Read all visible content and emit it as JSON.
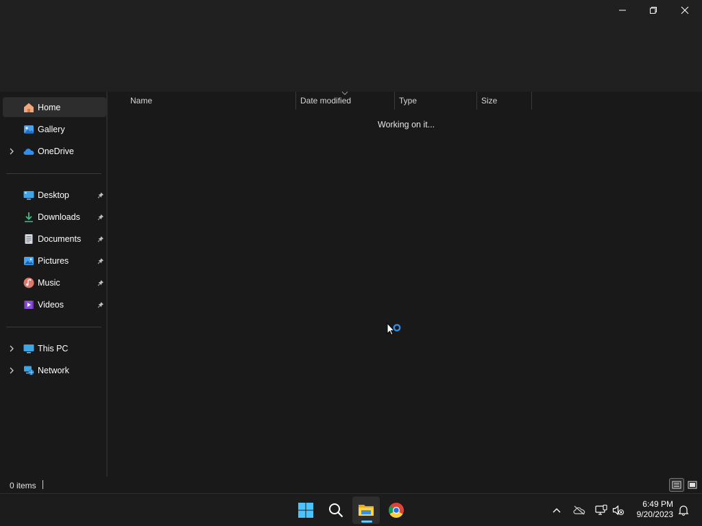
{
  "window": {
    "minimize_icon": "minimize-icon",
    "maximize_icon": "restore-icon",
    "close_icon": "close-icon"
  },
  "sidebar": {
    "quick": [
      {
        "label": "Home",
        "icon": "home-icon",
        "selected": true
      },
      {
        "label": "Gallery",
        "icon": "gallery-icon"
      },
      {
        "label": "OneDrive",
        "icon": "onedrive-icon",
        "expandable": true
      }
    ],
    "pinned": [
      {
        "label": "Desktop",
        "icon": "desktop-icon",
        "pinned": true
      },
      {
        "label": "Downloads",
        "icon": "downloads-icon",
        "pinned": true
      },
      {
        "label": "Documents",
        "icon": "documents-icon",
        "pinned": true
      },
      {
        "label": "Pictures",
        "icon": "pictures-icon",
        "pinned": true
      },
      {
        "label": "Music",
        "icon": "music-icon",
        "pinned": true
      },
      {
        "label": "Videos",
        "icon": "videos-icon",
        "pinned": true
      }
    ],
    "locations": [
      {
        "label": "This PC",
        "icon": "this-pc-icon",
        "expandable": true
      },
      {
        "label": "Network",
        "icon": "network-icon",
        "expandable": true
      }
    ]
  },
  "columns": {
    "name": "Name",
    "date_modified": "Date modified",
    "type": "Type",
    "size": "Size"
  },
  "content": {
    "status": "Working on it..."
  },
  "statusbar": {
    "items_count": "0 items"
  },
  "taskbar": {
    "apps": [
      "start-icon",
      "search-icon",
      "file-explorer-icon",
      "chrome-icon"
    ],
    "clock_time": "6:49 PM",
    "clock_date": "9/20/2023"
  },
  "colors": {
    "accent": "#60cdff",
    "background": "#191919",
    "titlebar": "#202020"
  }
}
